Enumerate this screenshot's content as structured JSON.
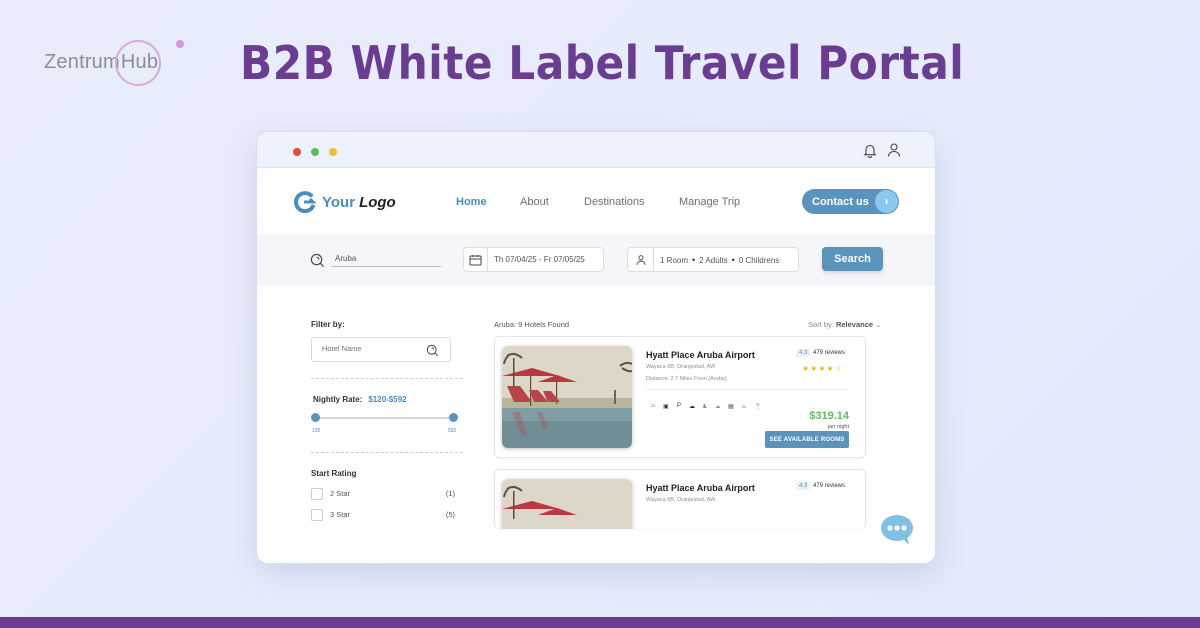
{
  "banner": {
    "brand_left": "Zentrum",
    "brand_right": "Hub",
    "headline": "B2B White Label Travel Portal",
    "colors": {
      "headline": "#6a3d92",
      "bottom_bar": "#6a3d92",
      "accent": "#5a93bb",
      "price": "#5cc065",
      "star": "#eab52a"
    }
  },
  "window": {
    "titlebar_icons": [
      "bell-icon",
      "user-icon"
    ]
  },
  "nav": {
    "logo_your": "Your",
    "logo_logo": "Logo",
    "links": [
      "Home",
      "About",
      "Destinations",
      "Manage Trip"
    ],
    "active": "Home",
    "contact_label": "Contact us",
    "contact_arrow": "›"
  },
  "search": {
    "destination": "Aruba",
    "dates": "Th 07/04/25  -  Fr 07/05/25",
    "rooms": "1 Room",
    "adults": "2 Adults",
    "children": "0 Childrens",
    "separator": "•",
    "button_label": "Search"
  },
  "filters": {
    "title": "Filter by:",
    "hotel_name_placeholder": "Hotel Name",
    "nightly_rate_label": "Nightly Rate:",
    "nightly_rate_value": "$120-$592",
    "slider_min": "120",
    "slider_max": "592",
    "rating_title": "Start Rating",
    "ratings": [
      {
        "label": "2 Star",
        "count": "(1)"
      },
      {
        "label": "3 Star",
        "count": "(5)"
      }
    ]
  },
  "results": {
    "count_text": "Aruba: 9 Hotels Found",
    "sort_prefix": "Sort by:",
    "sort_value": "Relevance",
    "sort_chevron": "⌄",
    "hotels": [
      {
        "name": "Hyatt Place Aruba Airport",
        "address": "Wayaca 6B, Oranjestad, AW",
        "distance": "Distance: 2.7 Miles From (Aruba)",
        "score": "4.3",
        "reviews": "479 reviews",
        "stars": 4,
        "stars_max": 5,
        "amenities": [
          "⌂",
          "▣",
          "P",
          "☁",
          "♿",
          "☕",
          "▤",
          "♨",
          "🍸"
        ],
        "price": "$319.14",
        "price_unit": "per night",
        "cta": "SEE AVAILABLE ROOMS"
      },
      {
        "name": "Hyatt Place Aruba Airport",
        "address": "Wayaca 6B, Oranjestad, AW",
        "score": "4.3",
        "reviews": "479 reviews"
      }
    ]
  },
  "chat": {
    "icon": "chat-bubble-icon"
  }
}
